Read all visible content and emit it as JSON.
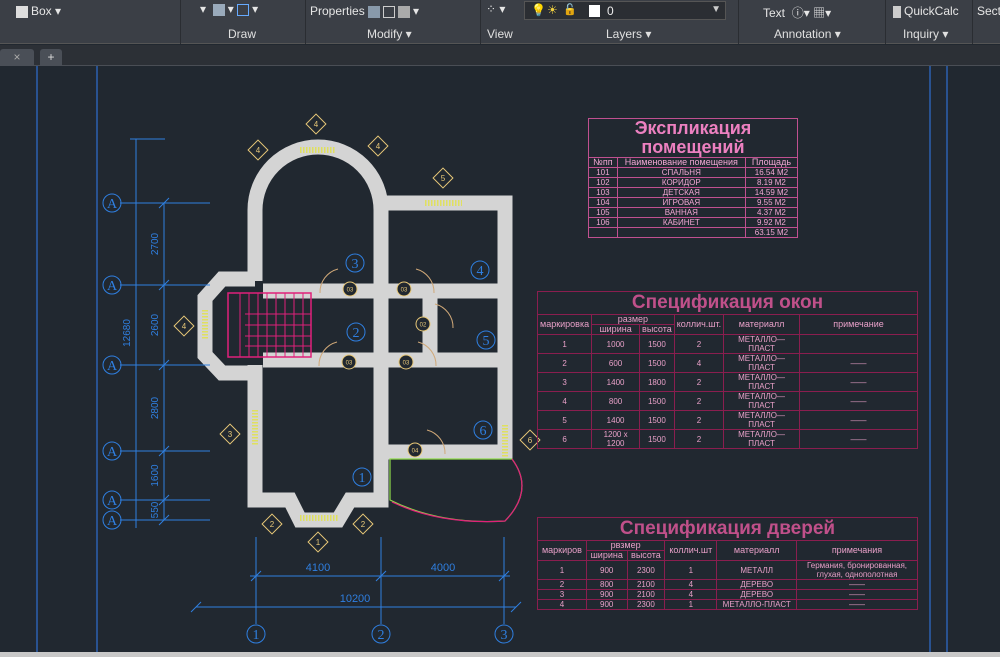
{
  "ribbon": {
    "box_label": "Box",
    "properties_label": "Properties",
    "layer_value": "0",
    "text_label": "Text",
    "quickcalc_label": "QuickCalc",
    "section_label": "Sect",
    "panels": [
      "Draw",
      "Modify ▾",
      "View",
      "Layers ▾",
      "Annotation ▾",
      "Inquiry ▾"
    ]
  },
  "tabs": {
    "close": "×",
    "new": "+"
  },
  "plan": {
    "dims_vertical": [
      "2700",
      "2600",
      "2800",
      "1600",
      "550"
    ],
    "dim_total_vertical": "12680",
    "dims_horizontal": [
      "4100",
      "4000"
    ],
    "dim_total_horizontal": "10200",
    "axis_rows": [
      "A",
      "A",
      "A",
      "A",
      "A",
      "A"
    ],
    "axis_cols": [
      "1",
      "2",
      "3"
    ],
    "rooms": [
      "1",
      "2",
      "3",
      "4",
      "5",
      "6"
    ],
    "doors": [
      "03",
      "03",
      "03",
      "03",
      "02",
      "04"
    ],
    "windows": [
      "4",
      "4",
      "4",
      "5",
      "4",
      "3",
      "6",
      "2",
      "2",
      "1"
    ]
  },
  "explication": {
    "title": "Экспликация помещений",
    "headers": [
      "№пп",
      "Наименование помещения",
      "Площадь"
    ],
    "rows": [
      [
        "101",
        "СПАЛЬНЯ",
        "16.54 М2"
      ],
      [
        "102",
        "КОРИДОР",
        "8.19 М2"
      ],
      [
        "103",
        "ДЕТСКАЯ",
        "14.59 М2"
      ],
      [
        "104",
        "ИГРОВАЯ",
        "9.55 М2"
      ],
      [
        "105",
        "ВАННАЯ",
        "4.37 М2"
      ],
      [
        "106",
        "КАБИНЕТ",
        "9.92 М2"
      ],
      [
        "",
        "",
        "63.15 М2"
      ]
    ]
  },
  "windows_spec": {
    "title": "Спецификация окон",
    "headers": {
      "mark": "маркировка",
      "size": "размер",
      "width": "ширина",
      "height": "высота",
      "qty": "коллич.шт.",
      "material": "материалл",
      "note": "примечание"
    },
    "rows": [
      [
        "1",
        "1000",
        "1500",
        "2",
        "МЕТАЛЛО—ПЛАСТ",
        ""
      ],
      [
        "2",
        "600",
        "1500",
        "4",
        "МЕТАЛЛО—ПЛАСТ",
        "——"
      ],
      [
        "3",
        "1400",
        "1800",
        "2",
        "МЕТАЛЛО—ПЛАСТ",
        "——"
      ],
      [
        "4",
        "800",
        "1500",
        "2",
        "МЕТАЛЛО—ПЛАСТ",
        "——"
      ],
      [
        "5",
        "1400",
        "1500",
        "2",
        "МЕТАЛЛО—ПЛАСТ",
        "——"
      ],
      [
        "6",
        "1200 x 1200",
        "1500",
        "2",
        "МЕТАЛЛО—ПЛАСТ",
        "——"
      ]
    ]
  },
  "doors_spec": {
    "title": "Спецификация дверей",
    "headers": {
      "mark": "маркиров",
      "size": "рвзмер",
      "width": "ширина",
      "height": "высота",
      "qty": "коллич.шт",
      "material": "материалл",
      "note": "примечания"
    },
    "rows": [
      [
        "1",
        "900",
        "2300",
        "1",
        "МЕТАЛЛ",
        "Германия, бронированная, глухая, однополотная"
      ],
      [
        "2",
        "800",
        "2100",
        "4",
        "ДЕРЕВО",
        "——"
      ],
      [
        "3",
        "900",
        "2100",
        "4",
        "ДЕРЕВО",
        "——"
      ],
      [
        "4",
        "900",
        "2300",
        "1",
        "МЕТАЛЛО-ПЛАСТ",
        "——"
      ]
    ]
  },
  "colors": {
    "canvas": "#212830",
    "wall": "#d4d4d4",
    "dim": "#2f7fe0",
    "marker": "#e8c878",
    "stair": "#e0207a",
    "table_line": "#8a1e4f"
  }
}
